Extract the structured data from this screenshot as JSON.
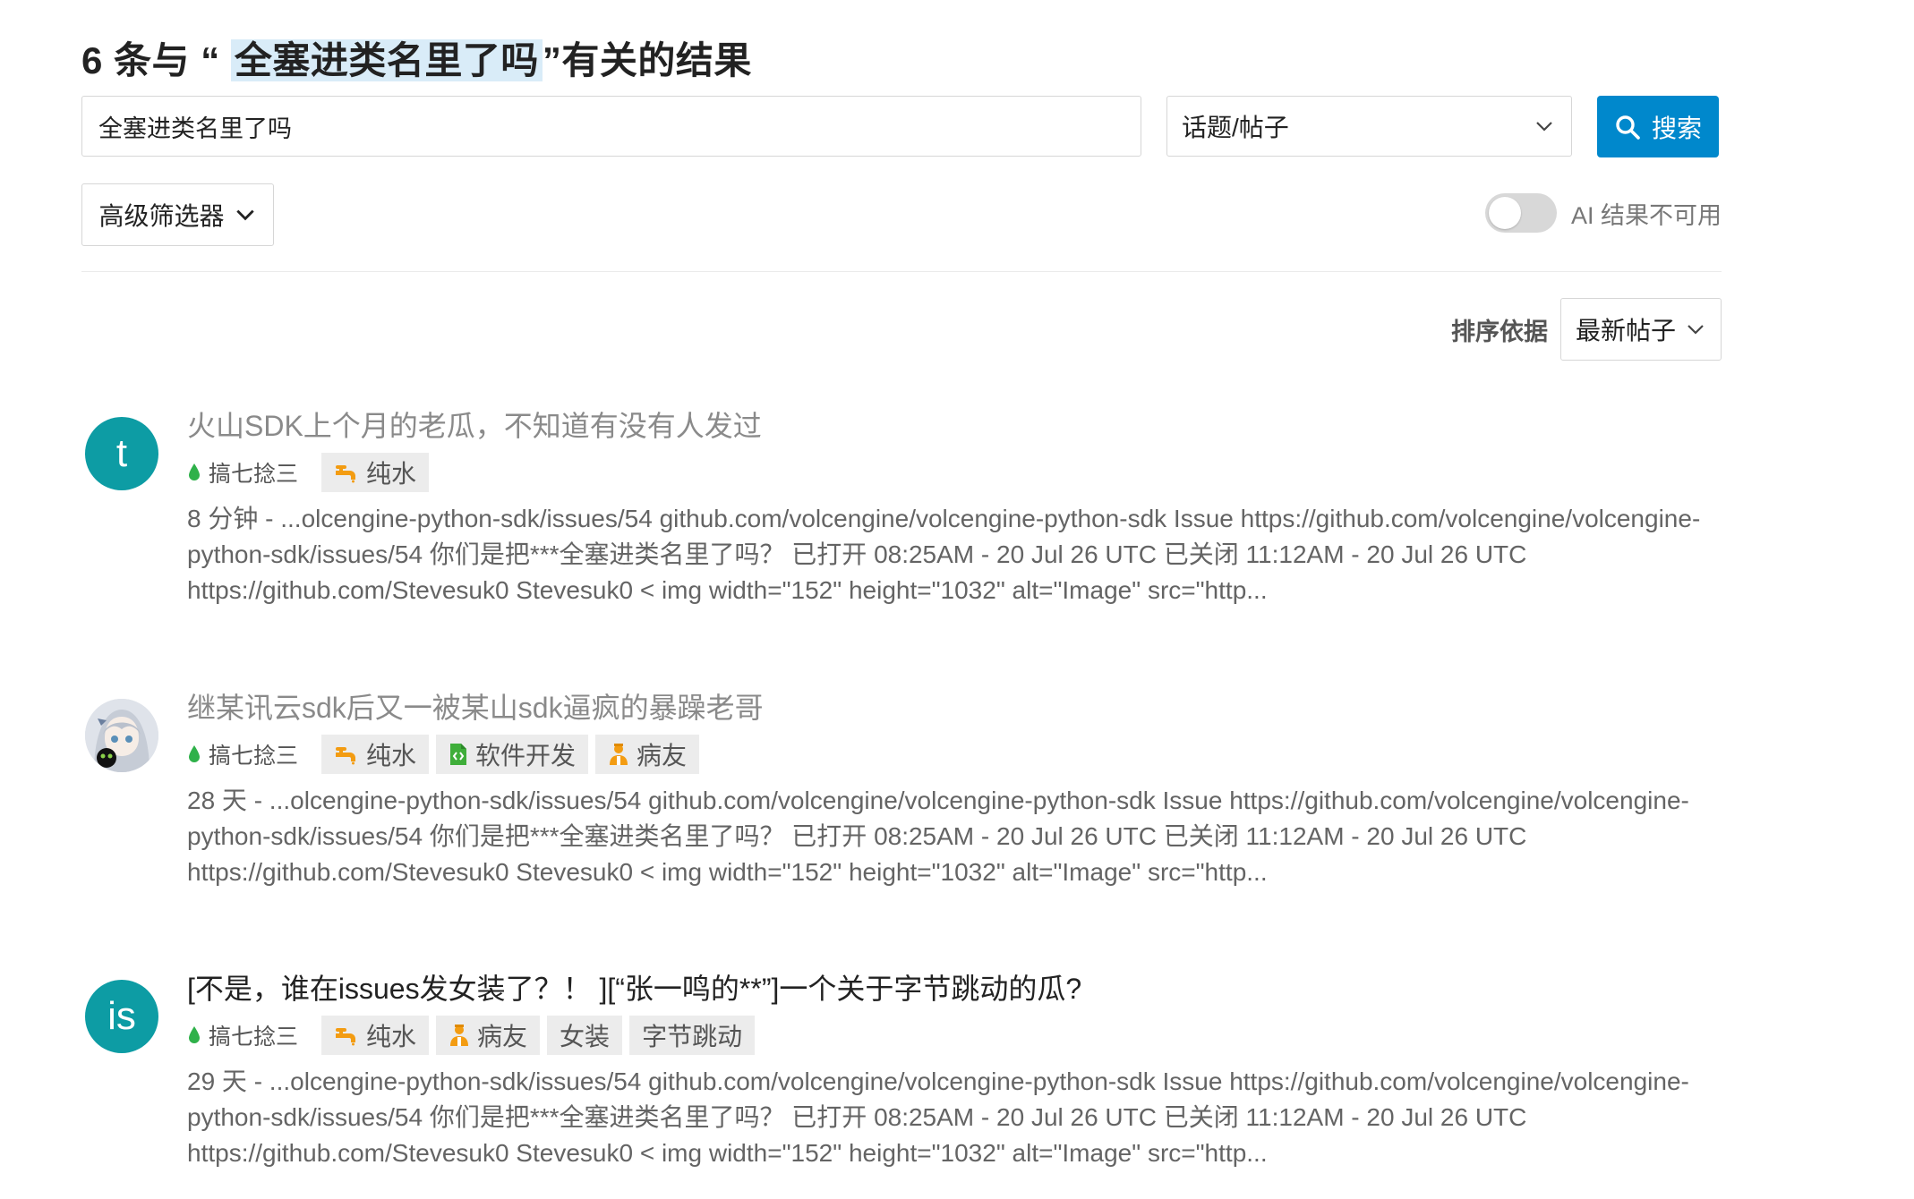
{
  "header": {
    "count_prefix": "6 条与 “ ",
    "query_highlight": "全塞进类名里了吗",
    "count_suffix": "”有关的结果"
  },
  "search": {
    "value": "全塞进类名里了吗",
    "type_selected": "话题/帖子",
    "button_label": "搜索"
  },
  "filters": {
    "advanced_label": "高级筛选器",
    "ai_label": "AI 结果不可用"
  },
  "sort": {
    "label": "排序依据",
    "selected": "最新帖子"
  },
  "colors": {
    "accent": "#0088cc",
    "avatar_teal": "#0d9ca4",
    "category_green": "#2fb14a",
    "tag_icon_orange": "#f39c12",
    "tag_icon_green": "#3fae3a"
  },
  "results": [
    {
      "avatar_letter": "t",
      "title": "火山SDK上个月的老瓜，不知道有没有人发过",
      "category": "搞七捻三",
      "tags": [
        {
          "label": "纯水",
          "icon": "faucet-icon"
        }
      ],
      "blurb": "8 分钟 - ...olcengine-python-sdk/issues/54 github.com/volcengine/volcengine-python-sdk Issue https://github.com/volcengine/volcengine-python-sdk/issues/54 你们是把***全塞进类名里了吗？  已打开 08:25AM - 20 Jul 26 UTC 已关闭 11:12AM - 20 Jul 26 UTC https://github.com/Stevesuk0 Stevesuk0 < img width=\"152\" height=\"1032\" alt=\"Image\" src=\"http..."
    },
    {
      "avatar_letter": "",
      "title": "继某讯云sdk后又一被某山sdk逼疯的暴躁老哥",
      "category": "搞七捻三",
      "tags": [
        {
          "label": "纯水",
          "icon": "faucet-icon"
        },
        {
          "label": "软件开发",
          "icon": "code-file-icon"
        },
        {
          "label": "病友",
          "icon": "person-icon"
        }
      ],
      "blurb": "28 天 - ...olcengine-python-sdk/issues/54 github.com/volcengine/volcengine-python-sdk Issue https://github.com/volcengine/volcengine-python-sdk/issues/54 你们是把***全塞进类名里了吗？  已打开 08:25AM - 20 Jul 26 UTC 已关闭 11:12AM - 20 Jul 26 UTC https://github.com/Stevesuk0 Stevesuk0 < img width=\"152\" height=\"1032\" alt=\"Image\" src=\"http..."
    },
    {
      "avatar_letter": "is",
      "title": "[不是，谁在issues发女装了？！ ][“张一鸣的**”]一个关于字节跳动的瓜?",
      "category": "搞七捻三",
      "tags": [
        {
          "label": "纯水",
          "icon": "faucet-icon"
        },
        {
          "label": "病友",
          "icon": "person-icon"
        },
        {
          "label": "女装",
          "icon": ""
        },
        {
          "label": "字节跳动",
          "icon": ""
        }
      ],
      "blurb": "29 天 - ...olcengine-python-sdk/issues/54 github.com/volcengine/volcengine-python-sdk Issue https://github.com/volcengine/volcengine-python-sdk/issues/54 你们是把***全塞进类名里了吗？  已打开 08:25AM - 20 Jul 26 UTC 已关闭 11:12AM - 20 Jul 26 UTC https://github.com/Stevesuk0 Stevesuk0 < img width=\"152\" height=\"1032\" alt=\"Image\" src=\"http..."
    }
  ]
}
